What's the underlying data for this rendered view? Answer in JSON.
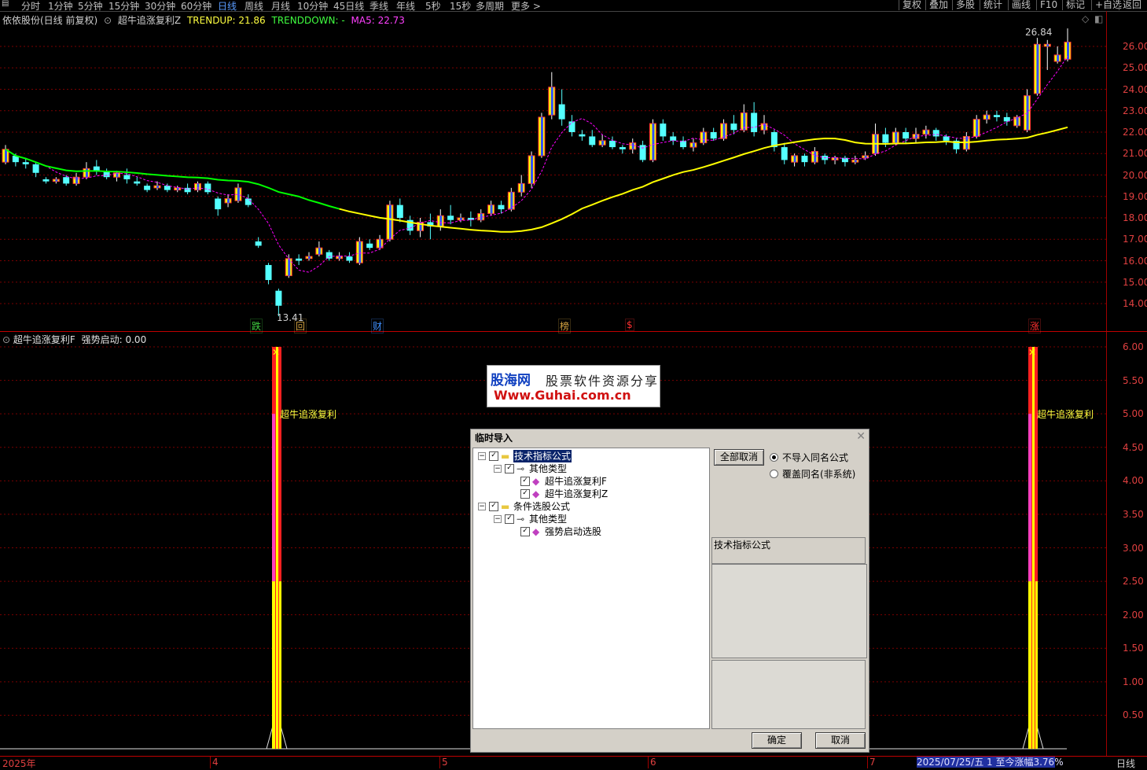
{
  "toolbar": {
    "tabs": [
      "分时",
      "1分钟",
      "5分钟",
      "15分钟",
      "30分钟",
      "60分钟",
      "日线",
      "周线",
      "月线",
      "10分钟",
      "45日线",
      "季线",
      "年线",
      "5秒",
      "15秒",
      "多周期",
      "更多 >"
    ],
    "active_tab": "日线",
    "right_buttons": [
      "复权",
      "叠加",
      "多股",
      "统计",
      "画线",
      "F10",
      "标记",
      "+自选",
      "返回"
    ]
  },
  "main_chart": {
    "stock_title": "依依股份(日线 前复权)",
    "indicator_name": "超牛追涨复利Z",
    "trendup_label": "TRENDUP: 21.86",
    "trenddown_label": "TRENDDOWN: -",
    "ma5_label": "MA5: 22.73",
    "high_label": "26.84",
    "low_label": "13.41",
    "y_ticks": [
      "26.00",
      "25.00",
      "24.00",
      "23.00",
      "22.00",
      "21.00",
      "20.00",
      "19.00",
      "18.00",
      "17.00",
      "16.00",
      "15.00",
      "14.00"
    ],
    "markers": [
      {
        "text": "跌",
        "color": "#40d040"
      },
      {
        "text": "回",
        "color": "#d0a040"
      },
      {
        "text": "财",
        "color": "#4090ff"
      },
      {
        "text": "榜",
        "color": "#d0a040"
      },
      {
        "text": "$",
        "color": "#ff3030"
      },
      {
        "text": "涨",
        "color": "#ff3030"
      }
    ],
    "colors": {
      "up": "#ff3232",
      "down": "#54ffff",
      "yellow_line": "#ffff00",
      "green_line": "#00ff00",
      "ma5": "#ff00ff"
    }
  },
  "indicator_panel": {
    "name": "超牛追涨复利F",
    "value_label": "强势启动: 0.00",
    "signal_label": "超牛追涨复利",
    "y_ticks": [
      "6.00",
      "5.50",
      "5.00",
      "4.50",
      "4.00",
      "3.50",
      "3.00",
      "2.50",
      "2.00",
      "1.50",
      "1.00",
      "0.50"
    ]
  },
  "x_axis": {
    "labels": [
      "2025年",
      "4",
      "5",
      "6",
      "7"
    ],
    "status": "2025/07/25/五 1 至今涨幅3.76%",
    "period_label": "日线"
  },
  "watermark": {
    "brand": "股海网",
    "slogan": "股票软件资源分享",
    "url": "Www.Guhai.com.cn"
  },
  "dialog": {
    "title": "临时导入",
    "tree": [
      {
        "label": "技术指标公式",
        "level": 0,
        "selected": true
      },
      {
        "label": "其他类型",
        "level": 1
      },
      {
        "label": "超牛追涨复利F",
        "level": 2
      },
      {
        "label": "超牛追涨复利Z",
        "level": 2
      },
      {
        "label": "条件选股公式",
        "level": 0
      },
      {
        "label": "其他类型",
        "level": 1
      },
      {
        "label": "强势启动选股",
        "level": 2
      }
    ],
    "cancel_all_label": "全部取消",
    "radio_no_import": "不导入同名公式",
    "radio_overwrite": "覆盖同名(非系统)",
    "info_title": "技术指标公式",
    "ok_label": "确定",
    "cancel_label": "取消"
  }
}
